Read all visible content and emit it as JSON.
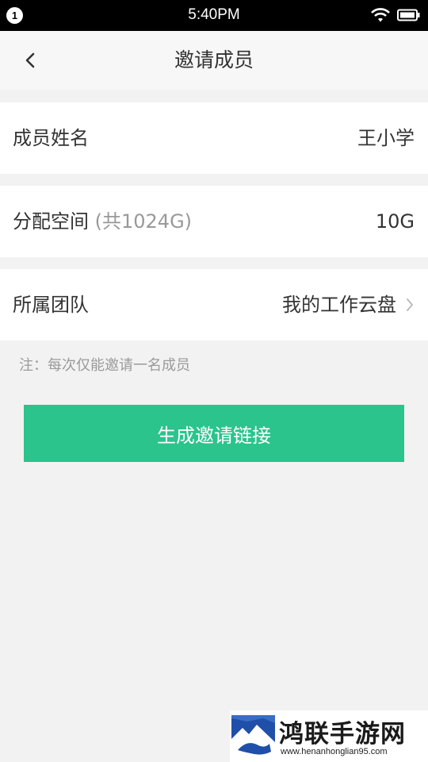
{
  "status_bar": {
    "notification_count": "1",
    "time": "5:40PM"
  },
  "nav": {
    "title": "邀请成员"
  },
  "form": {
    "member_name": {
      "label": "成员姓名",
      "value": "王小学"
    },
    "space": {
      "label": "分配空间",
      "hint": "(共1024G)",
      "value": "10G"
    },
    "team": {
      "label": "所属团队",
      "value": "我的工作云盘"
    }
  },
  "note": "注：每次仅能邀请一名成员",
  "generate_button_label": "生成邀请链接",
  "watermark": {
    "title": "鸿联手游网",
    "url": "www.henanhonglian95.com"
  },
  "colors": {
    "accent": "#2ac48c",
    "background": "#f2f2f2",
    "text": "#333333",
    "hint": "#999999"
  }
}
